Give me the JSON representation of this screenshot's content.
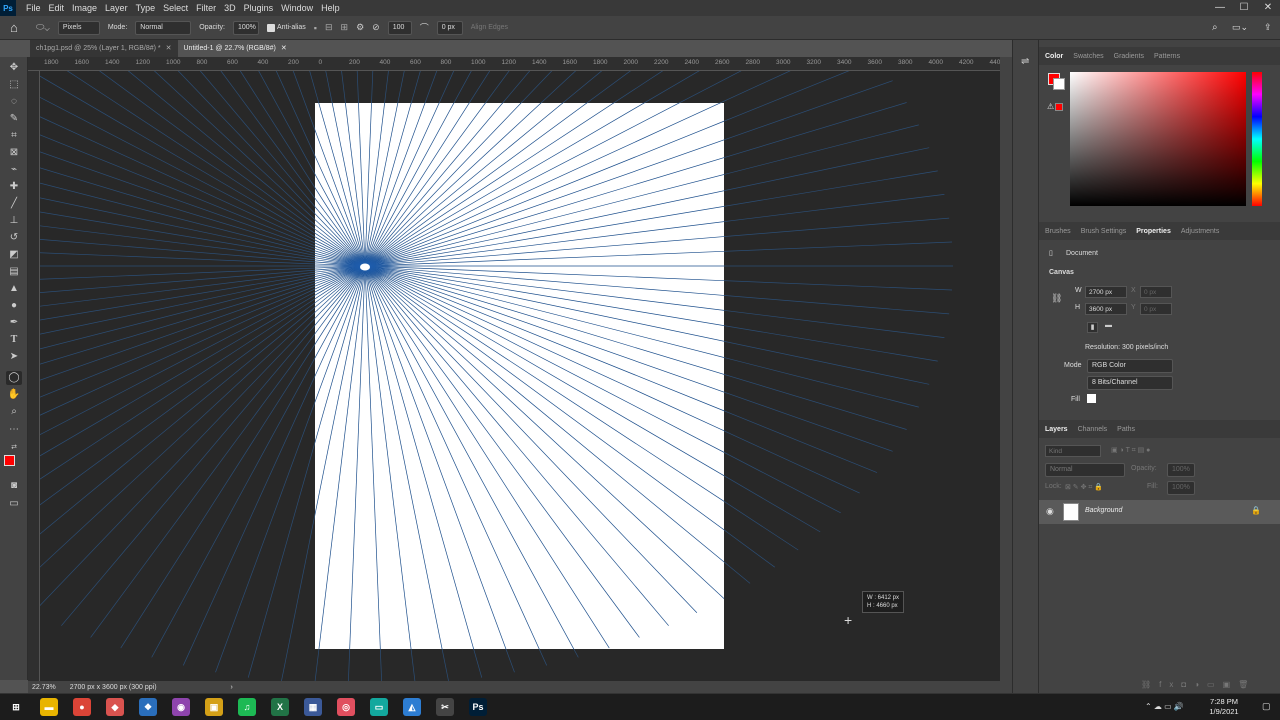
{
  "app": {
    "logo": "Ps"
  },
  "menu": [
    "File",
    "Edit",
    "Image",
    "Layer",
    "Type",
    "Select",
    "Filter",
    "3D",
    "Plugins",
    "Window",
    "Help"
  ],
  "window_controls": {
    "minimize": "—",
    "maximize": "☐",
    "close": "✕"
  },
  "options": {
    "preset": "Pixels",
    "mode_label": "Mode:",
    "mode_value": "Normal",
    "opacity_label": "Opacity:",
    "opacity_value": "100%",
    "antialias_label": "Anti-alias",
    "angle_value": "100",
    "radius_value": "0 px",
    "align_edges": "Align Edges"
  },
  "tabs": [
    {
      "label": "ch1pg1.psd @ 25% (Layer 1, RGB/8#) *"
    },
    {
      "label": "Untitled-1 @ 22.7% (RGB/8#)"
    }
  ],
  "ruler_top": [
    "1800",
    "1600",
    "1400",
    "1200",
    "1000",
    "800",
    "600",
    "400",
    "200",
    "0",
    "200",
    "400",
    "600",
    "800",
    "1000",
    "1200",
    "1400",
    "1600",
    "1800",
    "2000",
    "2200",
    "2400",
    "2600",
    "2800",
    "3000",
    "3200",
    "3400",
    "3600",
    "3800",
    "4000",
    "4200",
    "4400"
  ],
  "tooltip": {
    "w": "W :  6412 px",
    "h": "H :  4660 px"
  },
  "status": {
    "zoom": "22.73%",
    "doc_info": "2700 px x 3600 px (300 ppi)"
  },
  "colors": {
    "foreground": "#ff0000",
    "background": "#ffffff",
    "accent": "#2f6db5",
    "ray_color": "#1d4f8c",
    "canvas_bg": "#282828"
  },
  "color_panel": {
    "tabs": [
      "Color",
      "Swatches",
      "Gradients",
      "Patterns"
    ]
  },
  "properties_panel": {
    "tabs": [
      "Brushes",
      "Brush Settings",
      "Properties",
      "Adjustments"
    ],
    "doc_label": "Document",
    "canvas_label": "Canvas",
    "w_label": "W",
    "w_value": "2700 px",
    "h_label": "H",
    "h_value": "3600 px",
    "x_label": "X",
    "x_value": "0 px",
    "y_label": "Y",
    "y_value": "0 px",
    "resolution": "Resolution: 300 pixels/inch",
    "mode_label": "Mode",
    "mode_value": "RGB Color",
    "bits_value": "8 Bits/Channel",
    "fill_label": "Fill"
  },
  "layers_panel": {
    "tabs": [
      "Layers",
      "Channels",
      "Paths"
    ],
    "kind_placeholder": "Kind",
    "blend": "Normal",
    "opacity_label": "Opacity:",
    "opacity_value": "100%",
    "lock_label": "Lock:",
    "fill_label": "Fill:",
    "fill_value": "100%",
    "layers": [
      {
        "name": "Background"
      }
    ]
  },
  "taskbar": {
    "time": "7:28 PM",
    "date": "1/9/2021",
    "apps": [
      {
        "name": "start",
        "glyph": "⊞",
        "color": "#1c1c1c"
      },
      {
        "name": "file-explorer",
        "glyph": "▬",
        "color": "#e8b400"
      },
      {
        "name": "chrome",
        "glyph": "●",
        "color": "#db4437"
      },
      {
        "name": "app-3",
        "glyph": "◆",
        "color": "#d9534f"
      },
      {
        "name": "app-4",
        "glyph": "❖",
        "color": "#2a6ebb"
      },
      {
        "name": "app-5",
        "glyph": "◉",
        "color": "#8e44ad"
      },
      {
        "name": "app-6",
        "glyph": "▣",
        "color": "#d4a017"
      },
      {
        "name": "spotify",
        "glyph": "♫",
        "color": "#1db954"
      },
      {
        "name": "excel",
        "glyph": "X",
        "color": "#217346"
      },
      {
        "name": "calculator",
        "glyph": "▦",
        "color": "#3b5998"
      },
      {
        "name": "app-10",
        "glyph": "◎",
        "color": "#e04f5f"
      },
      {
        "name": "app-11",
        "glyph": "▭",
        "color": "#13a89e"
      },
      {
        "name": "app-12",
        "glyph": "◭",
        "color": "#2d7dd2"
      },
      {
        "name": "app-13",
        "glyph": "✂",
        "color": "#444"
      },
      {
        "name": "photoshop",
        "glyph": "Ps",
        "color": "#001e36"
      }
    ]
  }
}
